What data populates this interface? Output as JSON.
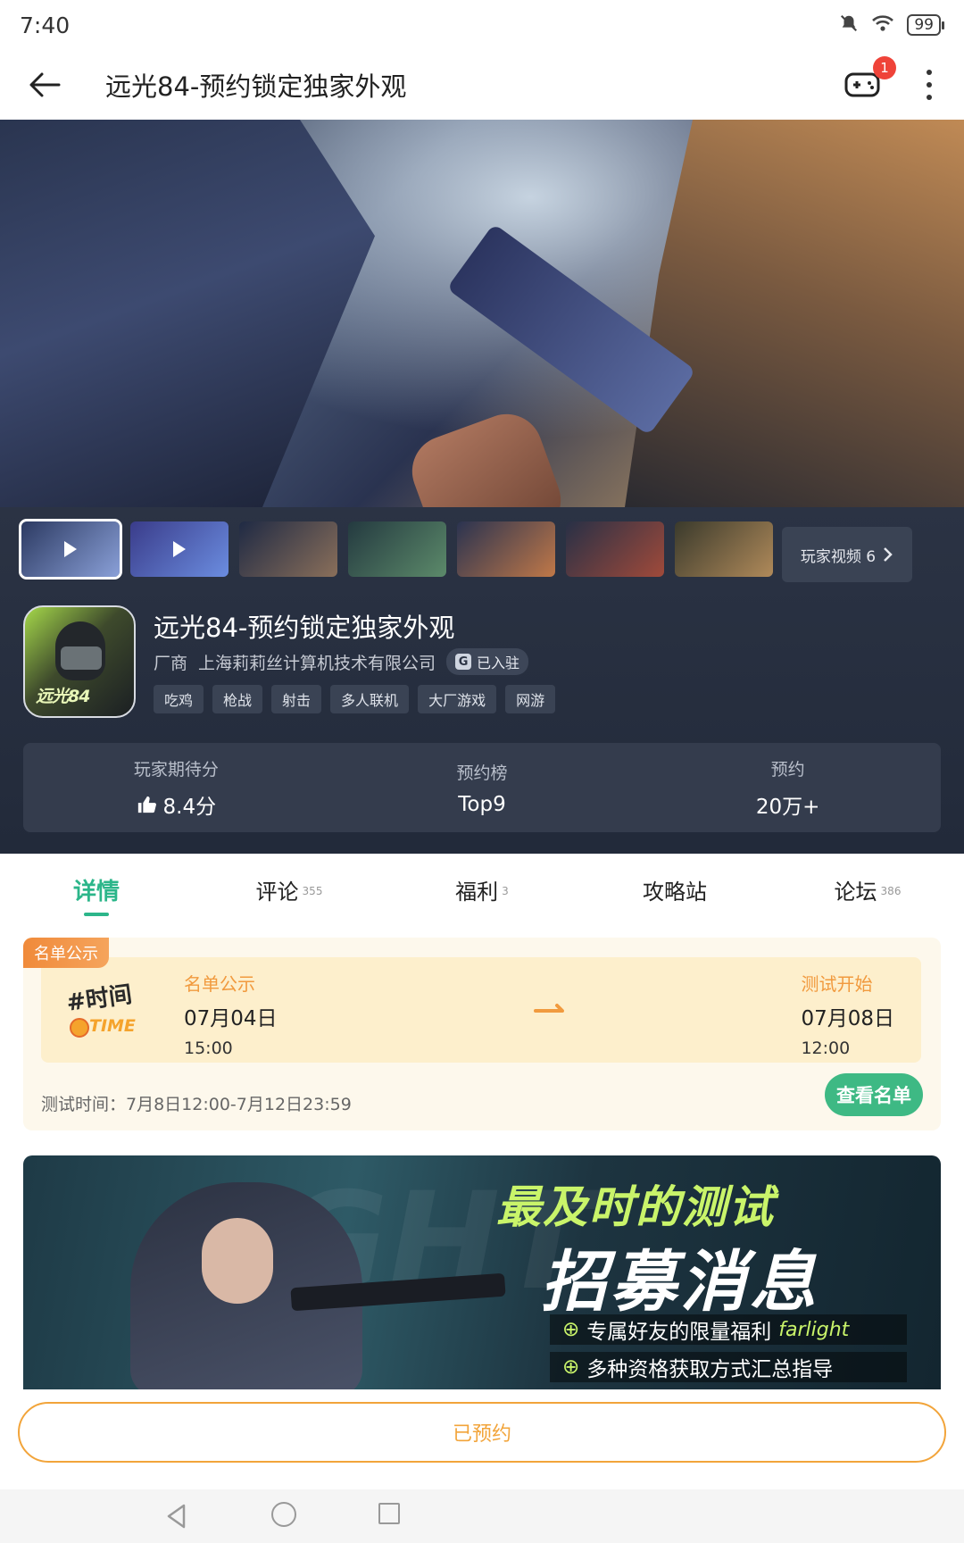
{
  "status_bar": {
    "time": "7:40",
    "battery": "99",
    "icons": [
      "bell-off-icon",
      "wifi-icon",
      "battery-icon"
    ]
  },
  "header": {
    "title": "远光84-预约锁定独家外观",
    "notification_count": "1",
    "icons": [
      "back-arrow-icon",
      "gamepad-icon",
      "more-vertical-icon"
    ]
  },
  "media": {
    "thumbnail_count": 7,
    "videos_label": "玩家视频 6"
  },
  "app": {
    "title": "远光84-预约锁定独家外观",
    "developer_label": "厂商",
    "developer": "上海莉莉丝计算机技术有限公司",
    "settled_label": "已入驻",
    "icon_logo": "远光84",
    "tags": [
      "吃鸡",
      "枪战",
      "射击",
      "多人联机",
      "大厂游戏",
      "网游"
    ]
  },
  "stats": [
    {
      "label": "玩家期待分",
      "value": "8.4分"
    },
    {
      "label": "预约榜",
      "value": "Top9"
    },
    {
      "label": "预约",
      "value": "20万+"
    }
  ],
  "tabs": [
    {
      "label": "详情",
      "count": ""
    },
    {
      "label": "评论",
      "count": "355"
    },
    {
      "label": "福利",
      "count": "3"
    },
    {
      "label": "攻略站",
      "count": ""
    },
    {
      "label": "论坛",
      "count": "386"
    }
  ],
  "schedule": {
    "ribbon": "名单公示",
    "logo_main": "#时间",
    "logo_sub": "TIME",
    "start": {
      "label": "名单公示",
      "date": "07月04日",
      "time": "15:00"
    },
    "end": {
      "label": "测试开始",
      "date": "07月08日",
      "time": "12:00"
    },
    "test_period": "测试时间：7月8日12:00-7月12日23:59",
    "view_button": "查看名单"
  },
  "banner": {
    "bg_text": "IGHT",
    "headline_1": "最及时的测试",
    "headline_2": "招募消息",
    "line_1": "专属好友的限量福利",
    "line_1_script": "farlight",
    "line_2": "多种资格获取方式汇总指导"
  },
  "bottom": {
    "reserve_button": "已预约"
  },
  "colors": {
    "accent_green": "#2cb68a",
    "accent_orange": "#f2a43a",
    "dark_panel": "#2b3344"
  }
}
